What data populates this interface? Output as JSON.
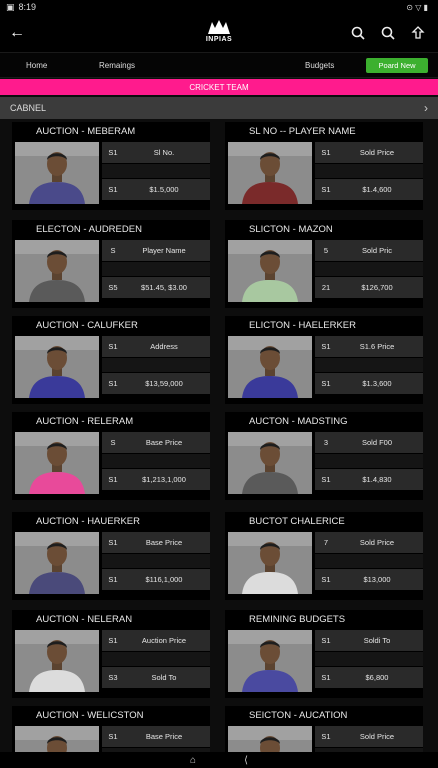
{
  "status": {
    "time": "8:19",
    "indicators": "⊙ ▽ ▮"
  },
  "app": {
    "logo_text": "INPIAS"
  },
  "nav": {
    "home": "Home",
    "remaining": "Remaings",
    "budgets": "Budgets",
    "new_button": "Poard New"
  },
  "banner": {
    "text": "CRICKET TEAM"
  },
  "channel": {
    "label": "CABNEL",
    "arrow": "›"
  },
  "cards": [
    {
      "title": "AUCTION - MEBERAM",
      "rows": [
        [
          "S1",
          "Sl No."
        ],
        [
          "",
          ""
        ],
        [
          "S1",
          "$1.5,000"
        ]
      ],
      "jersey": "#4a4a8a"
    },
    {
      "title": "SL NO  -- PLAYER NAME",
      "rows": [
        [
          "S1",
          "Sold Price"
        ],
        [
          "",
          ""
        ],
        [
          "S1",
          "$1.4,600"
        ]
      ],
      "jersey": "#7a2a2a"
    },
    {
      "title": "ELECTON - AUDREDEN",
      "rows": [
        [
          "S",
          "Player Name"
        ],
        [
          "",
          ""
        ],
        [
          "S5",
          "$51.45, $3.00"
        ]
      ],
      "jersey": "#5a5a5a"
    },
    {
      "title": "SLICTON - MAZON",
      "rows": [
        [
          "5",
          "Sold Pric"
        ],
        [
          "",
          ""
        ],
        [
          "21",
          "$126,700"
        ]
      ],
      "jersey": "#a8c8a0"
    },
    {
      "title": "AUCTION - CALUFKER",
      "rows": [
        [
          "S1",
          "Address"
        ],
        [
          "",
          ""
        ],
        [
          "S1",
          "$13,59,000"
        ]
      ],
      "jersey": "#3a3a9a"
    },
    {
      "title": "ELICTON - HAELERKER",
      "rows": [
        [
          "S1",
          "S1.6 Price"
        ],
        [
          "",
          ""
        ],
        [
          "S1",
          "$1.3,600"
        ]
      ],
      "jersey": "#3a3a9a"
    },
    {
      "title": "AUCTION - RELERAM",
      "rows": [
        [
          "S",
          "Base Price"
        ],
        [
          "",
          ""
        ],
        [
          "S1",
          "$1,213,1,000"
        ]
      ],
      "jersey": "#e84a9a"
    },
    {
      "title": "AUCTON - MADSTING",
      "rows": [
        [
          "3",
          "Sold F00"
        ],
        [
          "",
          ""
        ],
        [
          "S1",
          "$1.4,830"
        ]
      ],
      "jersey": "#5a5a5a"
    },
    {
      "title": "AUCTION - HAUERKER",
      "rows": [
        [
          "S1",
          "Base Price"
        ],
        [
          "",
          ""
        ],
        [
          "S1",
          "$116,1,000"
        ]
      ],
      "jersey": "#4a4a7a"
    },
    {
      "title": "BUCTOT  CHALERICE",
      "rows": [
        [
          "7",
          "Sold Price"
        ],
        [
          "",
          ""
        ],
        [
          "S1",
          "$13,000"
        ]
      ],
      "jersey": "#dcdcdc"
    },
    {
      "title": "AUCTION - NELERAN",
      "rows": [
        [
          "S1",
          "Auction Price"
        ],
        [
          "",
          ""
        ],
        [
          "S3",
          "Sold To"
        ]
      ],
      "jersey": "#dcdcdc"
    },
    {
      "title": "REMINING BUDGETS",
      "rows": [
        [
          "S1",
          "Soldi To"
        ],
        [
          "",
          ""
        ],
        [
          "S1",
          "$6,800"
        ]
      ],
      "jersey": "#4a4aa0"
    },
    {
      "title": "AUCTION - WELICSTON",
      "rows": [
        [
          "S1",
          "Base Price"
        ],
        [
          "",
          ""
        ],
        [
          "",
          ""
        ]
      ],
      "jersey": "#4a4a7a"
    },
    {
      "title": "SEICTON - AUCATION",
      "rows": [
        [
          "S1",
          "Sold Price"
        ],
        [
          "",
          ""
        ],
        [
          "",
          ""
        ]
      ],
      "jersey": "#4a4a7a"
    }
  ],
  "colors": {
    "accent_pink": "#ff1b8d",
    "button_green": "#3cb02f",
    "card_bg": "#000000",
    "row_bg": "#2a2a2a"
  }
}
